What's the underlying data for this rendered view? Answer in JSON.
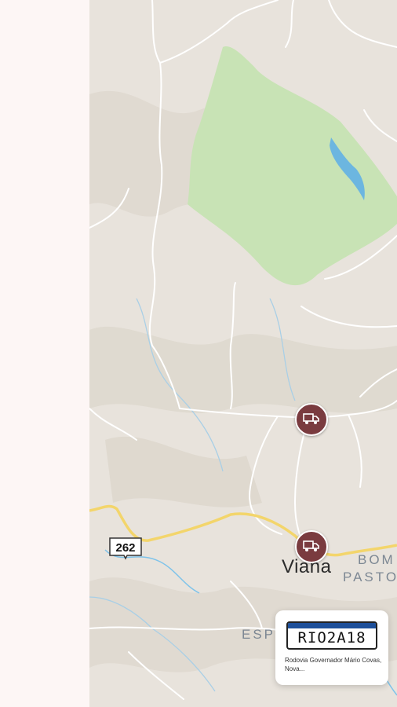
{
  "map": {
    "city_label": "Viana",
    "district_labels": [
      "BOM",
      "PASTO",
      "ESP"
    ],
    "road_shield": "262",
    "colors": {
      "terrain": "#e8e3dc",
      "park": "#c8e3b5",
      "water": "#6cb6e0",
      "roads": "#ffffff",
      "highway": "#f3d56b",
      "marker": "#7a3b3f"
    },
    "markers": [
      {
        "icon": "truck-icon"
      },
      {
        "icon": "truck-icon"
      }
    ]
  },
  "vehicle_card": {
    "plate": "RIO2A18",
    "address": "Rodovia Governador Mário Covas, Nova..."
  }
}
